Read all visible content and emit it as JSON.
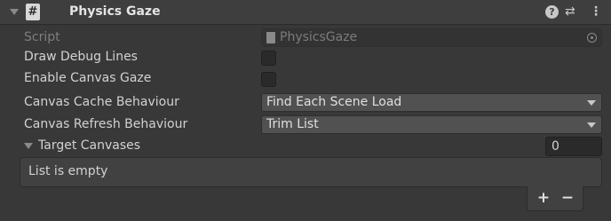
{
  "component": {
    "title": "Physics Gaze",
    "script_icon_glyph": "#",
    "help_glyph": "?",
    "preset_glyph": "⇄",
    "menu_glyph": "⋮"
  },
  "fields": {
    "script_label": "Script",
    "script_value": "PhysicsGaze",
    "draw_debug_lines_label": "Draw Debug Lines",
    "draw_debug_lines_checked": false,
    "enable_canvas_gaze_label": "Enable Canvas Gaze",
    "enable_canvas_gaze_checked": false,
    "canvas_cache_behaviour_label": "Canvas Cache Behaviour",
    "canvas_cache_behaviour_value": "Find Each Scene Load",
    "canvas_refresh_behaviour_label": "Canvas Refresh Behaviour",
    "canvas_refresh_behaviour_value": "Trim List"
  },
  "target_canvases": {
    "label": "Target Canvases",
    "size": "0",
    "empty_text": "List is empty",
    "add_label": "+",
    "remove_label": "−"
  },
  "colors": {
    "background": "#383838",
    "header": "#3e3e3e",
    "dropdown": "#515151",
    "field": "#2a2a2a"
  }
}
